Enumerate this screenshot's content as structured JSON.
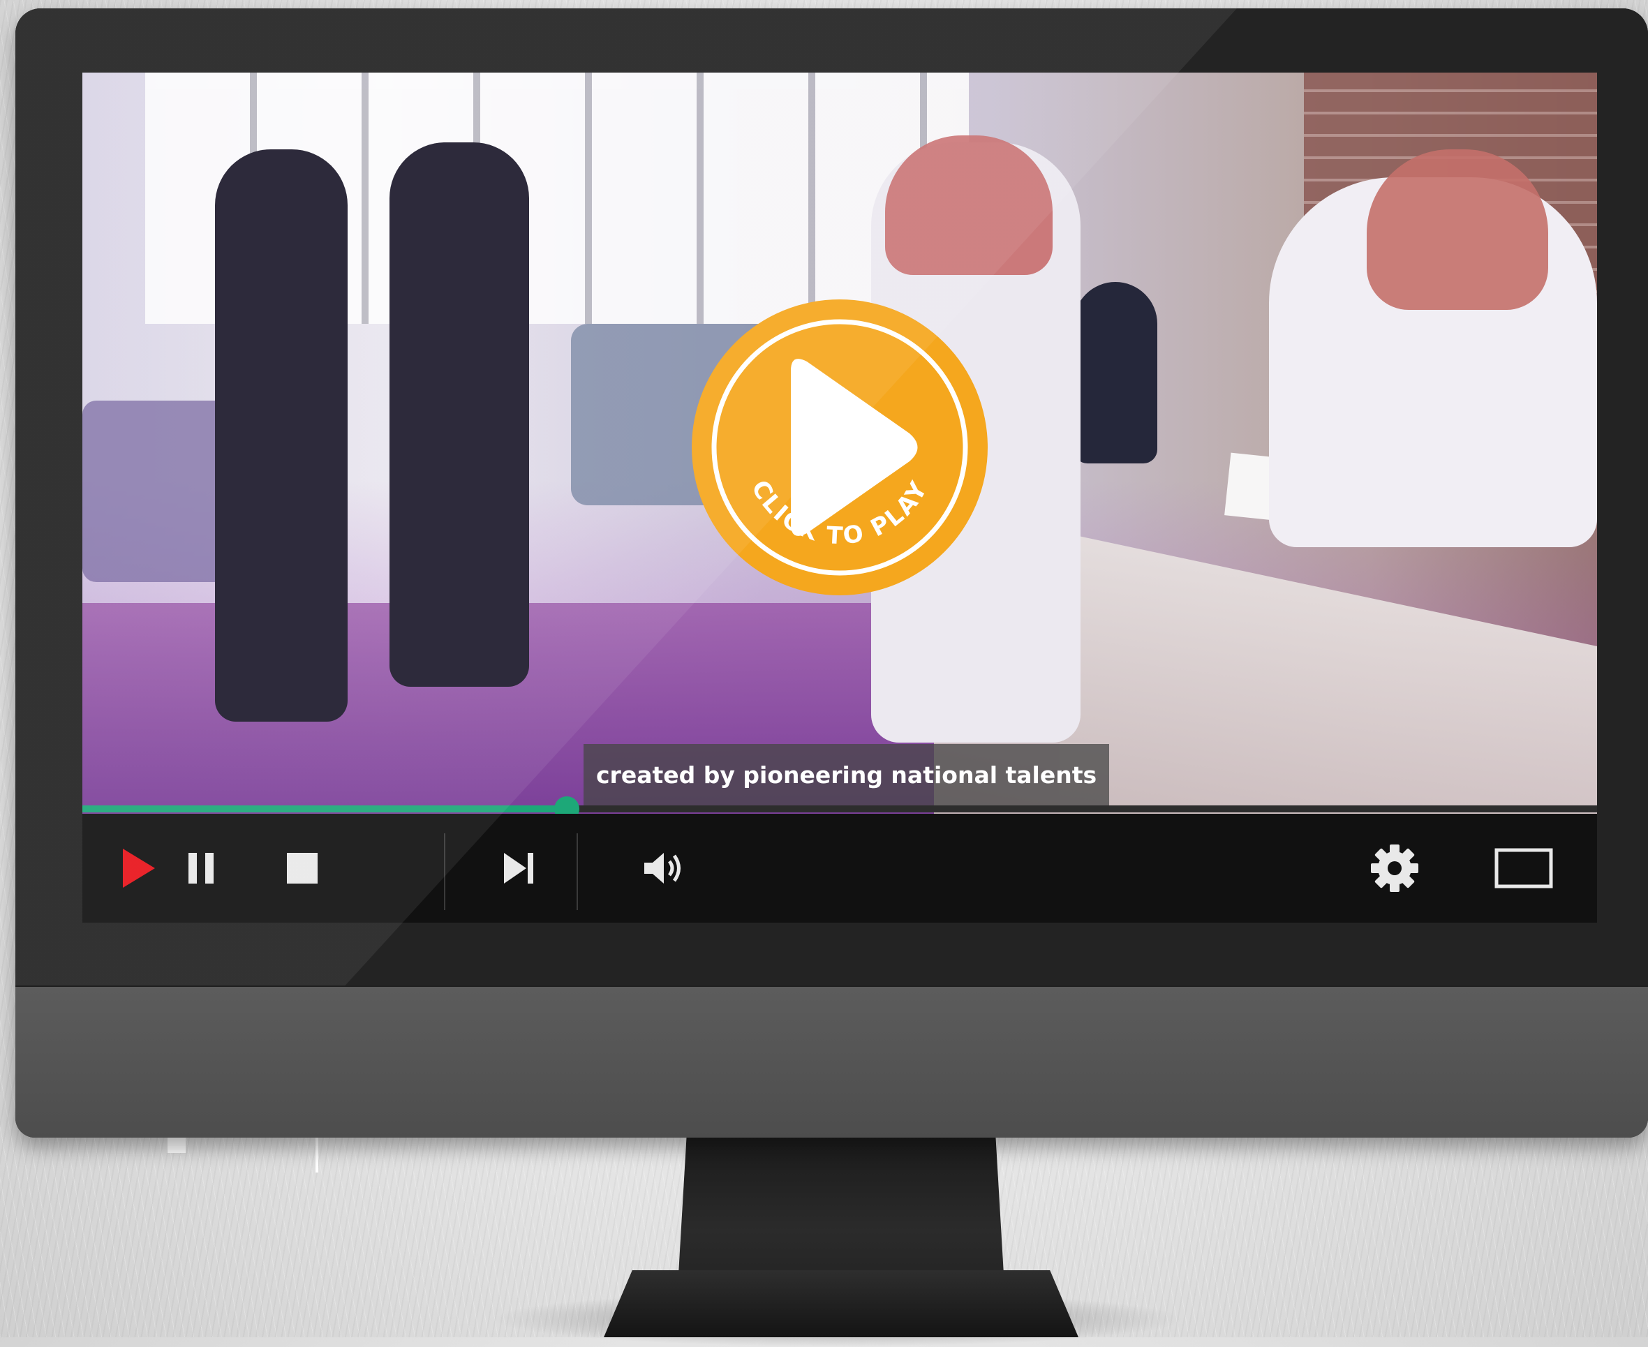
{
  "player": {
    "subtitle": "created by pioneering national talents",
    "overlay_label": "CLICK TO PLAY",
    "progress_fraction": 0.32
  },
  "controls": {
    "icons": [
      "play-icon",
      "pause-icon",
      "stop-icon",
      "skip-next-icon",
      "volume-icon",
      "gear-icon",
      "fullscreen-icon"
    ]
  },
  "colors": {
    "overlay_accent": "#F5A71E",
    "progress": "#1DA878",
    "play_icon": "#E8141B",
    "control_bar": "#111111"
  }
}
